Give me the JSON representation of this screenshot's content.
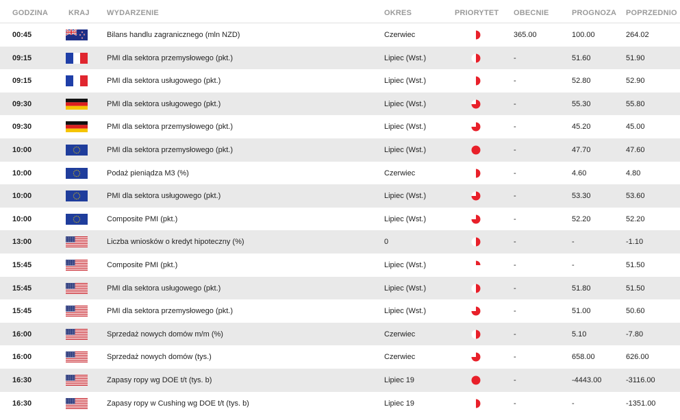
{
  "headers": {
    "time": "GODZINA",
    "country": "KRAJ",
    "event": "WYDARZENIE",
    "period": "OKRES",
    "priority": "PRIORYTET",
    "actual": "OBECNIE",
    "forecast": "PROGNOZA",
    "previous": "POPRZEDNIO"
  },
  "colors": {
    "priority_red": "#e8202a",
    "row_alt": "#e9e9e9",
    "header_text": "#9a9a9a"
  },
  "rows": [
    {
      "time": "00:45",
      "flag": "nz",
      "event": "Bilans handlu zagranicznego (mln NZD)",
      "period": "Czerwiec",
      "priority": 0.5,
      "actual": "365.00",
      "forecast": "100.00",
      "previous": "264.02"
    },
    {
      "time": "09:15",
      "flag": "fr",
      "event": "PMI dla sektora przemysłowego (pkt.)",
      "period": "Lipiec (Wst.)",
      "priority": 0.5,
      "actual": "-",
      "forecast": "51.60",
      "previous": "51.90"
    },
    {
      "time": "09:15",
      "flag": "fr",
      "event": "PMI dla sektora usługowego (pkt.)",
      "period": "Lipiec (Wst.)",
      "priority": 0.5,
      "actual": "-",
      "forecast": "52.80",
      "previous": "52.90"
    },
    {
      "time": "09:30",
      "flag": "de",
      "event": "PMI dla sektora usługowego (pkt.)",
      "period": "Lipiec (Wst.)",
      "priority": 0.75,
      "actual": "-",
      "forecast": "55.30",
      "previous": "55.80"
    },
    {
      "time": "09:30",
      "flag": "de",
      "event": "PMI dla sektora przemysłowego (pkt.)",
      "period": "Lipiec (Wst.)",
      "priority": 0.75,
      "actual": "-",
      "forecast": "45.20",
      "previous": "45.00"
    },
    {
      "time": "10:00",
      "flag": "eu",
      "event": "PMI dla sektora przemysłowego (pkt.)",
      "period": "Lipiec (Wst.)",
      "priority": 1,
      "actual": "-",
      "forecast": "47.70",
      "previous": "47.60"
    },
    {
      "time": "10:00",
      "flag": "eu",
      "event": "Podaż pieniądza M3 (%)",
      "period": "Czerwiec",
      "priority": 0.5,
      "actual": "-",
      "forecast": "4.60",
      "previous": "4.80"
    },
    {
      "time": "10:00",
      "flag": "eu",
      "event": "PMI dla sektora usługowego (pkt.)",
      "period": "Lipiec (Wst.)",
      "priority": 0.75,
      "actual": "-",
      "forecast": "53.30",
      "previous": "53.60"
    },
    {
      "time": "10:00",
      "flag": "eu",
      "event": "Composite PMI (pkt.)",
      "period": "Lipiec (Wst.)",
      "priority": 0.75,
      "actual": "-",
      "forecast": "52.20",
      "previous": "52.20"
    },
    {
      "time": "13:00",
      "flag": "us",
      "event": "Liczba wniosków o kredyt hipoteczny (%)",
      "period": "0",
      "priority": 0.5,
      "actual": "-",
      "forecast": "-",
      "previous": "-1.10"
    },
    {
      "time": "15:45",
      "flag": "us",
      "event": "Composite PMI (pkt.)",
      "period": "Lipiec (Wst.)",
      "priority": 0.25,
      "actual": "-",
      "forecast": "-",
      "previous": "51.50"
    },
    {
      "time": "15:45",
      "flag": "us",
      "event": "PMI dla sektora usługowego (pkt.)",
      "period": "Lipiec (Wst.)",
      "priority": 0.5,
      "actual": "-",
      "forecast": "51.80",
      "previous": "51.50"
    },
    {
      "time": "15:45",
      "flag": "us",
      "event": "PMI dla sektora przemysłowego (pkt.)",
      "period": "Lipiec (Wst.)",
      "priority": 0.75,
      "actual": "-",
      "forecast": "51.00",
      "previous": "50.60"
    },
    {
      "time": "16:00",
      "flag": "us",
      "event": "Sprzedaż nowych domów m/m (%)",
      "period": "Czerwiec",
      "priority": 0.5,
      "actual": "-",
      "forecast": "5.10",
      "previous": "-7.80"
    },
    {
      "time": "16:00",
      "flag": "us",
      "event": "Sprzedaż nowych domów (tys.)",
      "period": "Czerwiec",
      "priority": 0.75,
      "actual": "-",
      "forecast": "658.00",
      "previous": "626.00"
    },
    {
      "time": "16:30",
      "flag": "us",
      "event": "Zapasy ropy wg DOE t/t (tys. b)",
      "period": "Lipiec 19",
      "priority": 1,
      "actual": "-",
      "forecast": "-4443.00",
      "previous": "-3116.00"
    },
    {
      "time": "16:30",
      "flag": "us",
      "event": "Zapasy ropy w Cushing wg DOE t/t (tys. b)",
      "period": "Lipiec 19",
      "priority": 0.5,
      "actual": "-",
      "forecast": "-",
      "previous": "-1351.00"
    }
  ]
}
